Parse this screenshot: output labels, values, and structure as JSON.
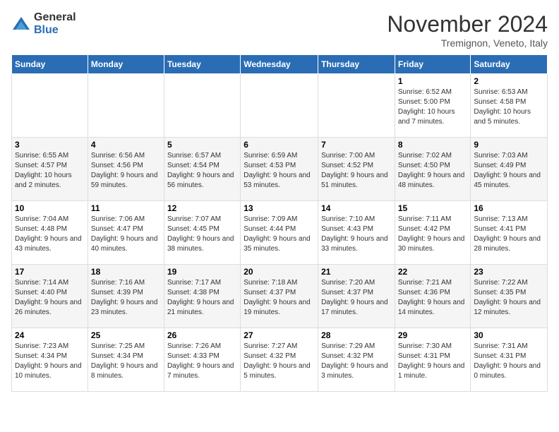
{
  "logo": {
    "general": "General",
    "blue": "Blue"
  },
  "title": "November 2024",
  "subtitle": "Tremignon, Veneto, Italy",
  "days_of_week": [
    "Sunday",
    "Monday",
    "Tuesday",
    "Wednesday",
    "Thursday",
    "Friday",
    "Saturday"
  ],
  "weeks": [
    [
      {
        "day": "",
        "info": ""
      },
      {
        "day": "",
        "info": ""
      },
      {
        "day": "",
        "info": ""
      },
      {
        "day": "",
        "info": ""
      },
      {
        "day": "",
        "info": ""
      },
      {
        "day": "1",
        "info": "Sunrise: 6:52 AM\nSunset: 5:00 PM\nDaylight: 10 hours and 7 minutes."
      },
      {
        "day": "2",
        "info": "Sunrise: 6:53 AM\nSunset: 4:58 PM\nDaylight: 10 hours and 5 minutes."
      }
    ],
    [
      {
        "day": "3",
        "info": "Sunrise: 6:55 AM\nSunset: 4:57 PM\nDaylight: 10 hours and 2 minutes."
      },
      {
        "day": "4",
        "info": "Sunrise: 6:56 AM\nSunset: 4:56 PM\nDaylight: 9 hours and 59 minutes."
      },
      {
        "day": "5",
        "info": "Sunrise: 6:57 AM\nSunset: 4:54 PM\nDaylight: 9 hours and 56 minutes."
      },
      {
        "day": "6",
        "info": "Sunrise: 6:59 AM\nSunset: 4:53 PM\nDaylight: 9 hours and 53 minutes."
      },
      {
        "day": "7",
        "info": "Sunrise: 7:00 AM\nSunset: 4:52 PM\nDaylight: 9 hours and 51 minutes."
      },
      {
        "day": "8",
        "info": "Sunrise: 7:02 AM\nSunset: 4:50 PM\nDaylight: 9 hours and 48 minutes."
      },
      {
        "day": "9",
        "info": "Sunrise: 7:03 AM\nSunset: 4:49 PM\nDaylight: 9 hours and 45 minutes."
      }
    ],
    [
      {
        "day": "10",
        "info": "Sunrise: 7:04 AM\nSunset: 4:48 PM\nDaylight: 9 hours and 43 minutes."
      },
      {
        "day": "11",
        "info": "Sunrise: 7:06 AM\nSunset: 4:47 PM\nDaylight: 9 hours and 40 minutes."
      },
      {
        "day": "12",
        "info": "Sunrise: 7:07 AM\nSunset: 4:45 PM\nDaylight: 9 hours and 38 minutes."
      },
      {
        "day": "13",
        "info": "Sunrise: 7:09 AM\nSunset: 4:44 PM\nDaylight: 9 hours and 35 minutes."
      },
      {
        "day": "14",
        "info": "Sunrise: 7:10 AM\nSunset: 4:43 PM\nDaylight: 9 hours and 33 minutes."
      },
      {
        "day": "15",
        "info": "Sunrise: 7:11 AM\nSunset: 4:42 PM\nDaylight: 9 hours and 30 minutes."
      },
      {
        "day": "16",
        "info": "Sunrise: 7:13 AM\nSunset: 4:41 PM\nDaylight: 9 hours and 28 minutes."
      }
    ],
    [
      {
        "day": "17",
        "info": "Sunrise: 7:14 AM\nSunset: 4:40 PM\nDaylight: 9 hours and 26 minutes."
      },
      {
        "day": "18",
        "info": "Sunrise: 7:16 AM\nSunset: 4:39 PM\nDaylight: 9 hours and 23 minutes."
      },
      {
        "day": "19",
        "info": "Sunrise: 7:17 AM\nSunset: 4:38 PM\nDaylight: 9 hours and 21 minutes."
      },
      {
        "day": "20",
        "info": "Sunrise: 7:18 AM\nSunset: 4:37 PM\nDaylight: 9 hours and 19 minutes."
      },
      {
        "day": "21",
        "info": "Sunrise: 7:20 AM\nSunset: 4:37 PM\nDaylight: 9 hours and 17 minutes."
      },
      {
        "day": "22",
        "info": "Sunrise: 7:21 AM\nSunset: 4:36 PM\nDaylight: 9 hours and 14 minutes."
      },
      {
        "day": "23",
        "info": "Sunrise: 7:22 AM\nSunset: 4:35 PM\nDaylight: 9 hours and 12 minutes."
      }
    ],
    [
      {
        "day": "24",
        "info": "Sunrise: 7:23 AM\nSunset: 4:34 PM\nDaylight: 9 hours and 10 minutes."
      },
      {
        "day": "25",
        "info": "Sunrise: 7:25 AM\nSunset: 4:34 PM\nDaylight: 9 hours and 8 minutes."
      },
      {
        "day": "26",
        "info": "Sunrise: 7:26 AM\nSunset: 4:33 PM\nDaylight: 9 hours and 7 minutes."
      },
      {
        "day": "27",
        "info": "Sunrise: 7:27 AM\nSunset: 4:32 PM\nDaylight: 9 hours and 5 minutes."
      },
      {
        "day": "28",
        "info": "Sunrise: 7:29 AM\nSunset: 4:32 PM\nDaylight: 9 hours and 3 minutes."
      },
      {
        "day": "29",
        "info": "Sunrise: 7:30 AM\nSunset: 4:31 PM\nDaylight: 9 hours and 1 minute."
      },
      {
        "day": "30",
        "info": "Sunrise: 7:31 AM\nSunset: 4:31 PM\nDaylight: 9 hours and 0 minutes."
      }
    ]
  ]
}
